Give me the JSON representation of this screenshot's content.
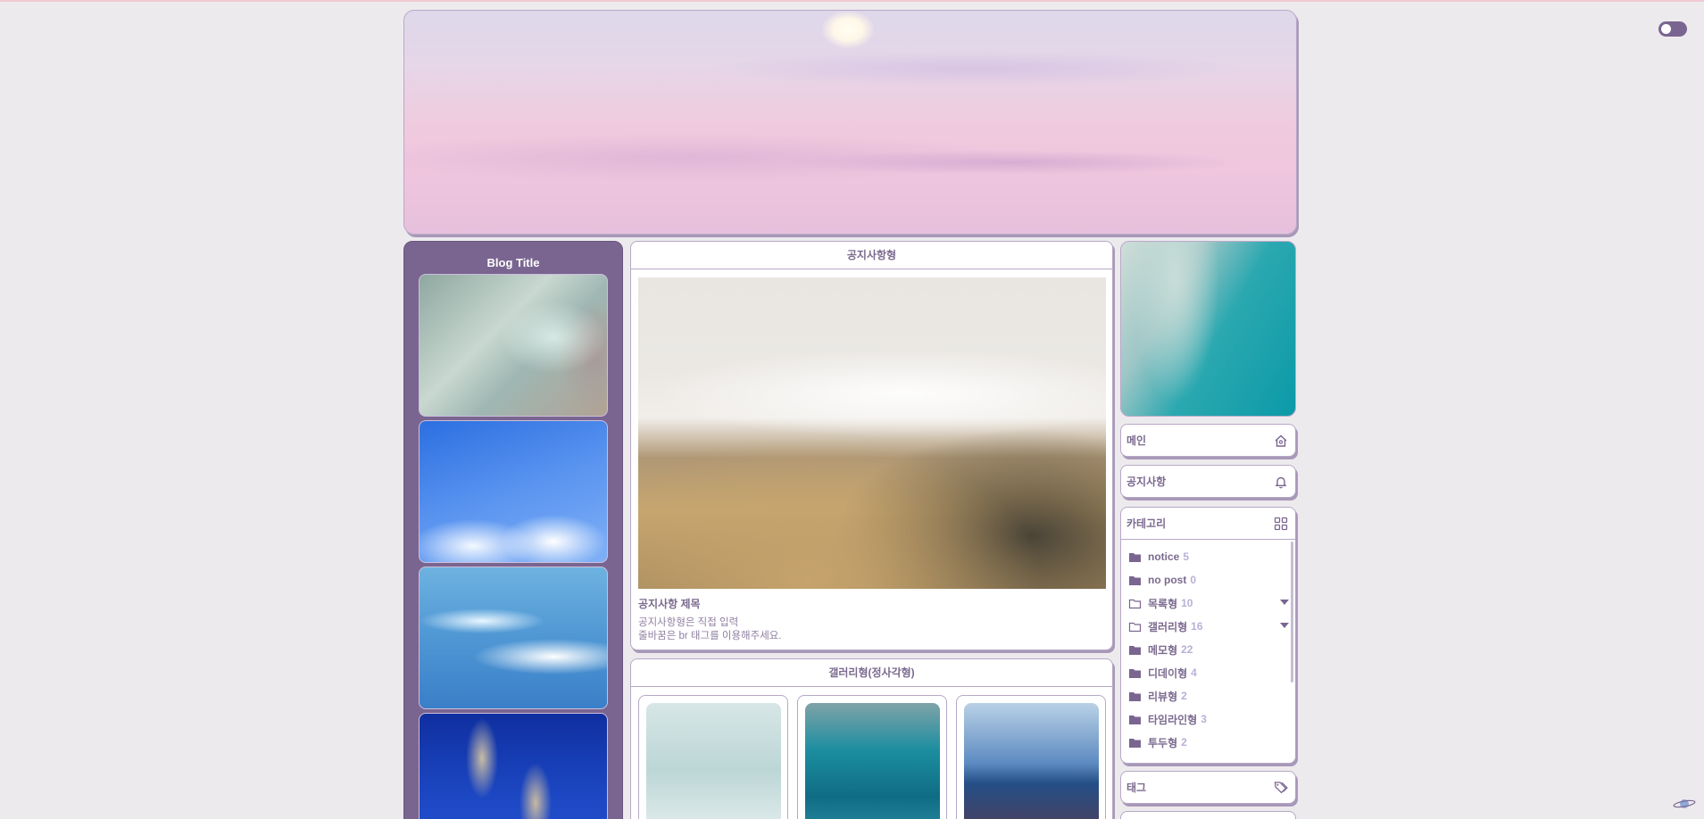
{
  "blog_title": "Blog Title",
  "notice_section": {
    "header": "공지사항형",
    "title": "공지사항 제목",
    "text_line1": "공지사항형은 직접 입력",
    "text_line2": "줄바꿈은 br 태그를 이용해주세요."
  },
  "gallery_section": {
    "header": "갤러리형(정사각형)"
  },
  "nav": {
    "main": "메인",
    "notice": "공지사항",
    "category": "카테고리",
    "tag": "태그"
  },
  "categories": [
    {
      "name": "notice",
      "count": "5",
      "icon": "folder-filled"
    },
    {
      "name": "no post",
      "count": "0",
      "icon": "folder-filled"
    },
    {
      "name": "목록형",
      "count": "10",
      "icon": "folder-outline",
      "expandable": true
    },
    {
      "name": "갤러리형",
      "count": "16",
      "icon": "folder-outline",
      "expandable": true
    },
    {
      "name": "메모형",
      "count": "22",
      "icon": "folder-filled"
    },
    {
      "name": "디데이형",
      "count": "4",
      "icon": "folder-filled"
    },
    {
      "name": "리뷰형",
      "count": "2",
      "icon": "folder-filled"
    },
    {
      "name": "타임라인형",
      "count": "3",
      "icon": "folder-filled"
    },
    {
      "name": "투두형",
      "count": "2",
      "icon": "folder-filled"
    }
  ],
  "colors": {
    "accent": "#7a6590",
    "text": "#7b6a8f",
    "count": "#b9b0d6",
    "background": "#edeaee"
  }
}
